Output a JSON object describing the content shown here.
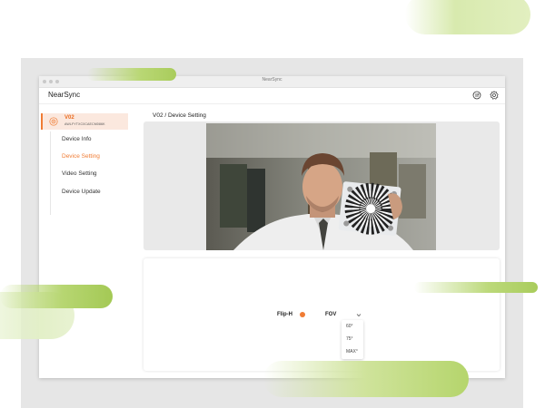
{
  "window": {
    "title": "NearSync"
  },
  "header": {
    "app_name": "NearSync",
    "icons": [
      "sync-icon",
      "settings-icon"
    ]
  },
  "sidebar": {
    "device": {
      "name": "V02",
      "serial": "AWLFYTXC0CAECM086K",
      "icon": "camera-icon"
    },
    "items": [
      {
        "label": "Device Info",
        "active": false
      },
      {
        "label": "Device Setting",
        "active": true
      },
      {
        "label": "Video Setting",
        "active": false
      },
      {
        "label": "Device Update",
        "active": false
      }
    ]
  },
  "main": {
    "breadcrumb": "V02 / Device Setting",
    "preview": {
      "description": "camera-preview-feed"
    },
    "controls": {
      "flip_label": "Flip-H",
      "fov_label": "FOV",
      "fov_options": [
        "60°",
        "75°",
        "MAX°"
      ]
    }
  },
  "colors": {
    "accent": "#f07c34",
    "accent_bg": "#fbe8de",
    "green": "#b5d56c"
  }
}
